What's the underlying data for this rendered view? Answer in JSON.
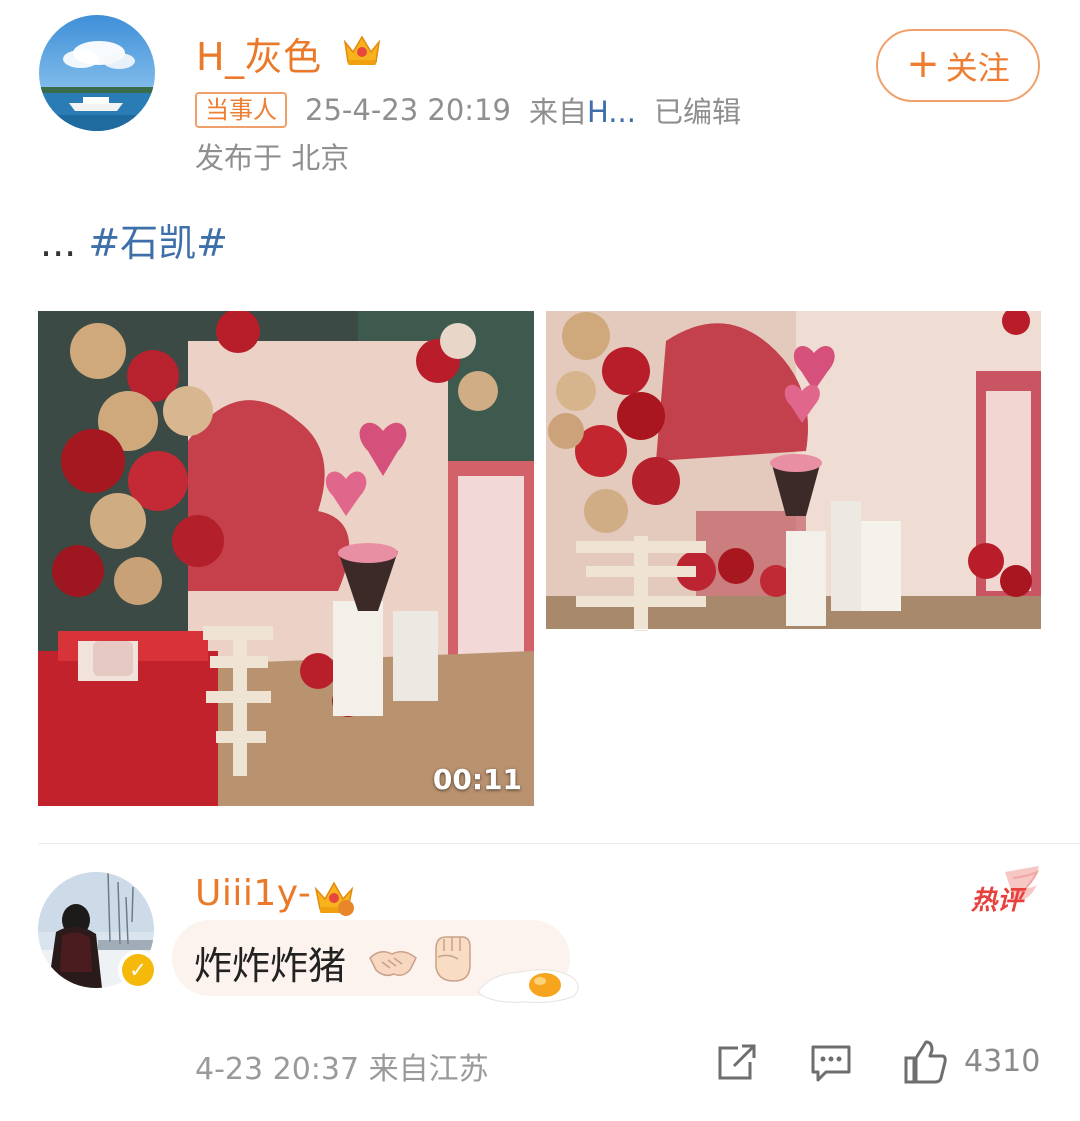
{
  "post": {
    "username": "H_灰色",
    "follow_label": "关注",
    "party_tag": "当事人",
    "time": "25-4-23 20:19",
    "source_prefix": "来自",
    "source_name": "H...",
    "edited": "已编辑",
    "location": "发布于 北京",
    "text_prefix": "...",
    "hashtag": "#石凯#",
    "video_duration": "00:11"
  },
  "comment": {
    "username": "Uiii1y-",
    "hot_label": "热评",
    "text": "炸炸炸猪",
    "time": "4-23 20:37",
    "source": "来自江苏",
    "likes": "4310",
    "emojis": [
      "handshake-emoji",
      "fist-emoji",
      "fried-egg-sticker"
    ]
  },
  "colors": {
    "accent_orange": "#ef7d32",
    "link_blue": "#3e6fa8",
    "meta_gray": "#8f8f8f",
    "hot_red": "#e8403d",
    "verified_gold": "#f5b90b"
  }
}
